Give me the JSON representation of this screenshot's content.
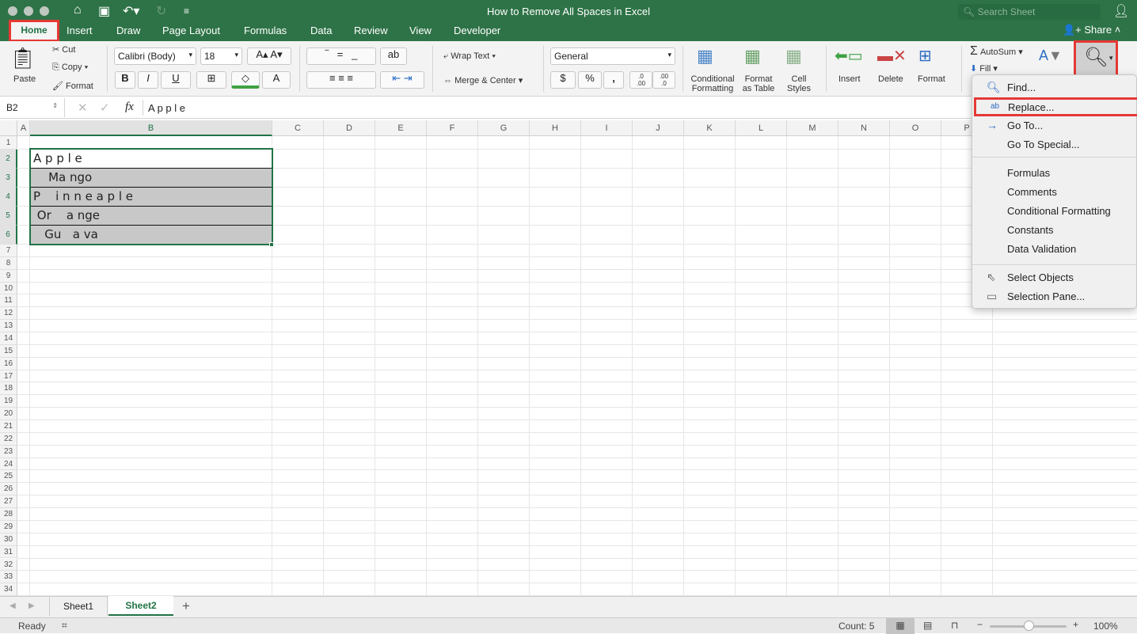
{
  "window": {
    "title": "How to Remove All Spaces in Excel",
    "search_placeholder": "Search Sheet",
    "share": "Share"
  },
  "tabs": [
    "Home",
    "Insert",
    "Draw",
    "Page Layout",
    "Formulas",
    "Data",
    "Review",
    "View",
    "Developer"
  ],
  "ribbon": {
    "paste": "Paste",
    "cut": "Cut",
    "copy": "Copy",
    "format_painter": "Format",
    "font": "Calibri (Body)",
    "size": "18",
    "bold": "B",
    "italic": "I",
    "underline": "U",
    "wrap_text": "Wrap Text",
    "merge_center": "Merge & Center",
    "number_format": "General",
    "currency": "$",
    "percent": "%",
    "comma": ",",
    "inc_decimal": ".0\n.00",
    "dec_decimal": ".00\n.0",
    "conditional_formatting": "Conditional Formatting",
    "format_as_table": "Format as Table",
    "cell_styles": "Cell Styles",
    "insert": "Insert",
    "delete": "Delete",
    "format": "Format",
    "autosum": "AutoSum",
    "fill": "Fill"
  },
  "formula_bar": {
    "name_box": "B2",
    "fx": "fx",
    "value": "A p p l e"
  },
  "columns": [
    "A",
    "B",
    "C",
    "D",
    "E",
    "F",
    "G",
    "H",
    "I",
    "J",
    "K",
    "L",
    "M",
    "N",
    "O",
    "P"
  ],
  "rows": 34,
  "cells": [
    "A p p l e",
    "    Ma ngo",
    "P    i n n e a p l e",
    " Or    a nge",
    "   Gu   a va"
  ],
  "find_menu": {
    "items": [
      "Find...",
      "Replace...",
      "Go To...",
      "Go To Special...",
      "Formulas",
      "Comments",
      "Conditional Formatting",
      "Constants",
      "Data Validation",
      "Select Objects",
      "Selection Pane..."
    ]
  },
  "sheets": [
    "Sheet1",
    "Sheet2"
  ],
  "active_sheet": "Sheet2",
  "status": {
    "ready": "Ready",
    "count": "Count: 5",
    "zoom": "100%",
    "zoom_level": 100
  },
  "colors": {
    "accent": "#217346",
    "highlight": "#e53935",
    "selection_fill": "#c8c8c8"
  }
}
